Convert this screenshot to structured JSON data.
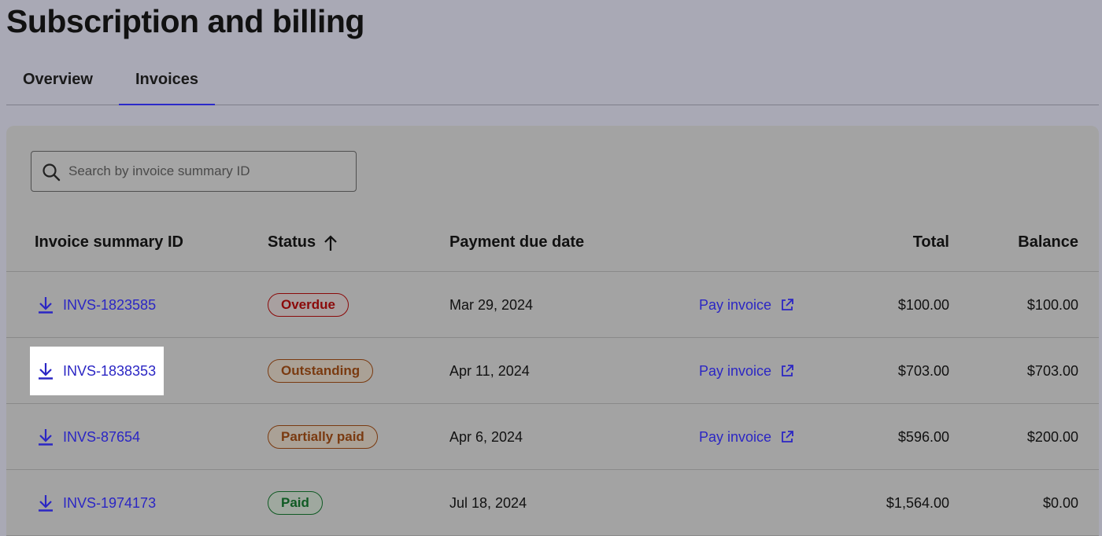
{
  "page": {
    "title": "Subscription and billing"
  },
  "tabs": [
    {
      "label": "Overview",
      "active": false
    },
    {
      "label": "Invoices",
      "active": true
    }
  ],
  "search": {
    "placeholder": "Search by invoice summary ID",
    "value": ""
  },
  "table": {
    "columns": {
      "id": "Invoice summary ID",
      "status": "Status",
      "due": "Payment due date",
      "total": "Total",
      "balance": "Balance"
    },
    "sort": {
      "column": "status",
      "direction": "ascending",
      "icon": "arrow-up-icon"
    },
    "pay_label": "Pay invoice",
    "rows": [
      {
        "id": "INVS-1823585",
        "status": "Overdue",
        "due": "Mar 29, 2024",
        "pay": "Pay invoice",
        "total": "$100.00",
        "balance": "$100.00"
      },
      {
        "id": "INVS-1838353",
        "status": "Outstanding",
        "due": "Apr 11, 2024",
        "pay": "Pay invoice",
        "total": "$703.00",
        "balance": "$703.00"
      },
      {
        "id": "INVS-87654",
        "status": "Partially paid",
        "due": "Apr 6, 2024",
        "pay": "Pay invoice",
        "total": "$596.00",
        "balance": "$200.00"
      },
      {
        "id": "INVS-1974173",
        "status": "Paid",
        "due": "Jul 18, 2024",
        "pay": "",
        "total": "$1,564.00",
        "balance": "$0.00"
      }
    ]
  },
  "colors": {
    "accent": "#2b26c4",
    "overdue": "#8b0a0a",
    "outstanding": "#7a3a10",
    "partially_paid": "#7a3a10",
    "paid": "#0f5a23"
  }
}
